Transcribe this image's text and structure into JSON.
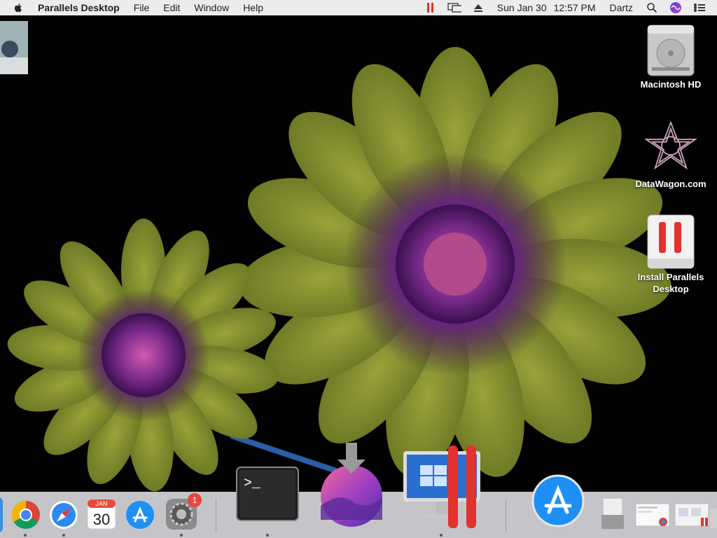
{
  "menubar": {
    "app_name": "Parallels Desktop",
    "menus": [
      "File",
      "Edit",
      "Window",
      "Help"
    ],
    "date": "Sun Jan 30",
    "time": "12:57 PM",
    "user": "Dartz",
    "icons": [
      "apple-icon",
      "parallels-status-icon",
      "display-mirroring-icon",
      "eject-icon",
      "search-icon",
      "siri-icon",
      "control-center-icon"
    ]
  },
  "desktop": {
    "icons": [
      {
        "label": "Macintosh HD",
        "icon": "hard-drive-icon"
      },
      {
        "label": "DataWagon.com",
        "icon": "datawagon-logo-icon"
      },
      {
        "label": "Install Parallels Desktop",
        "icon": "parallels-installer-icon"
      }
    ]
  },
  "dock": {
    "calendar": {
      "month": "JAN",
      "day": "30"
    },
    "settings_badge": "1",
    "terminal_prompt": ">_",
    "items": [
      "finder-icon",
      "chrome-icon",
      "safari-icon",
      "calendar-icon",
      "app-store-icon",
      "system-preferences-icon",
      "terminal-icon",
      "install-macos-monterey-icon",
      "parallels-desktop-icon",
      "app-store-installer-icon",
      "preview-icon",
      "window-thumbnail-icon",
      "window-thumbnail-icon",
      "trash-icon"
    ]
  },
  "colors": {
    "menubar_bg": "#ececec",
    "parallels_red": "#e2322d",
    "dock_bg": "#d6d6da",
    "badge": "#e8463b"
  }
}
